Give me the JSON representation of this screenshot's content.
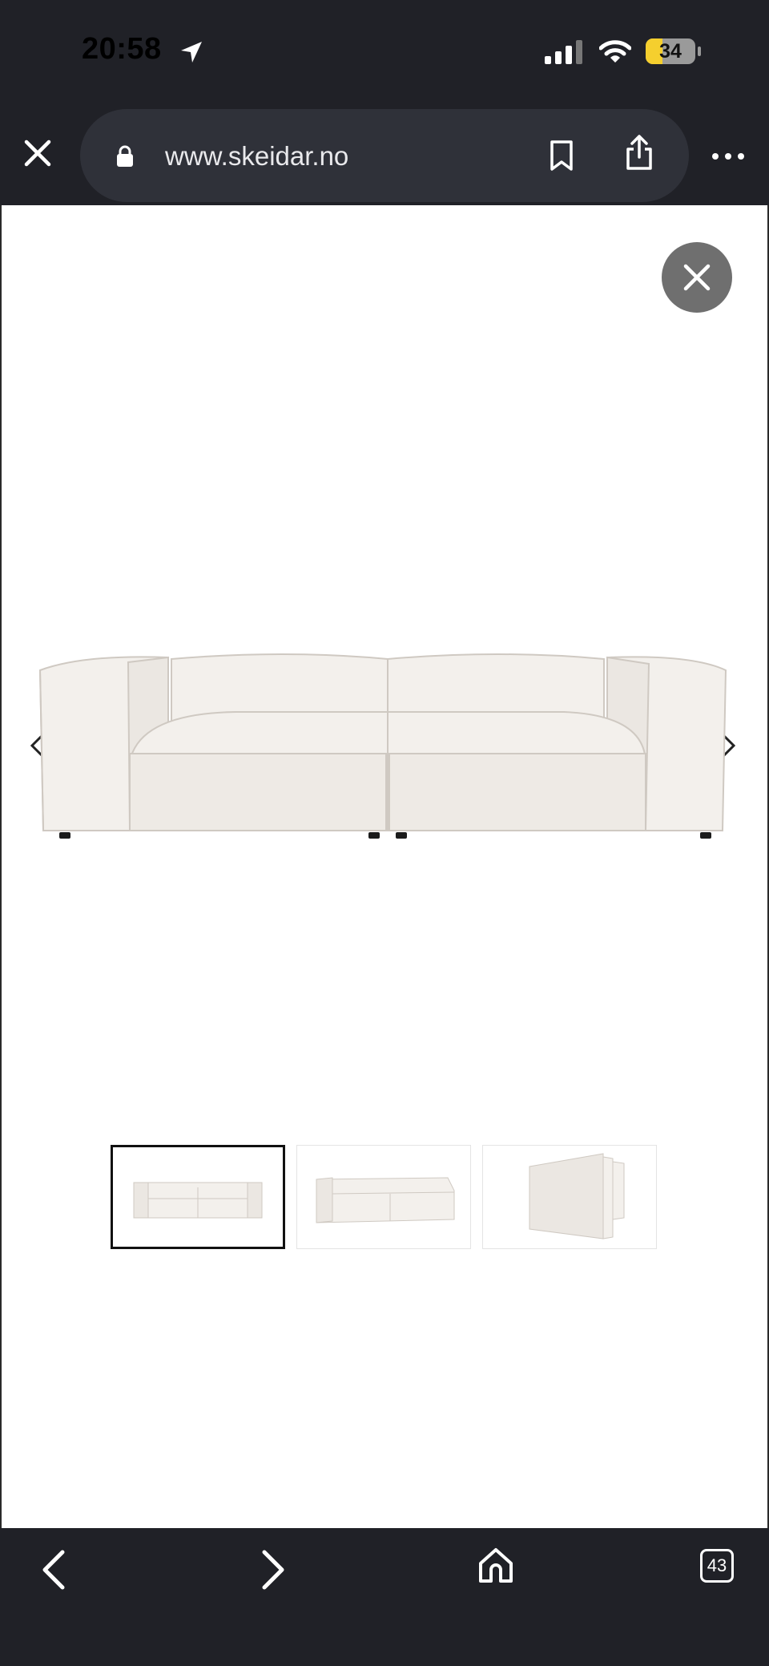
{
  "status_bar": {
    "time": "20:58",
    "battery_level": "34",
    "battery_fraction": 0.34
  },
  "browser": {
    "url": "www.skeidar.no",
    "tab_count": "43"
  },
  "gallery": {
    "image_count": 3,
    "active_index": 0,
    "thumbnails": [
      {
        "subject": "sofa-front"
      },
      {
        "subject": "sofa-angle"
      },
      {
        "subject": "sofa-side"
      }
    ]
  },
  "colors": {
    "chrome_bg": "#202127",
    "urlbar_bg": "#2f3139",
    "battery_fill": "#f5cf2e",
    "close_button_bg": "#6f6f6f",
    "sofa_fabric": "#f3f0ec"
  },
  "icons": {
    "location": "location-arrow-icon",
    "signal": "cellular-signal-icon",
    "wifi": "wifi-icon",
    "close_tab": "close-icon",
    "lock": "lock-icon",
    "bookmark": "bookmark-icon",
    "share": "share-icon",
    "more": "more-icon",
    "close_gallery": "close-icon",
    "prev": "chevron-left-icon",
    "next": "chevron-right-icon",
    "back": "back-icon",
    "forward": "forward-icon",
    "home": "home-icon"
  }
}
